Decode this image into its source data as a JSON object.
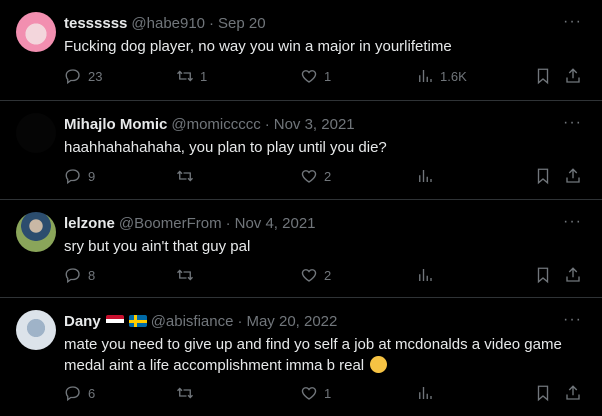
{
  "tweets": [
    {
      "name": "tessssss",
      "handle": "@habe910",
      "dot": "·",
      "date": "Sep 20",
      "text": "Fucking dog player, no way you win a major in yourlifetime",
      "replies": "23",
      "retweets": "1",
      "likes": "1",
      "views": "1.6K",
      "more": "···"
    },
    {
      "name": "Mihajlo Momic",
      "handle": "@momiccccc",
      "dot": "·",
      "date": "Nov 3, 2021",
      "text": "haahhahahahaha, you plan to play until you die?",
      "replies": "9",
      "retweets": "",
      "likes": "2",
      "views": "",
      "more": "···"
    },
    {
      "name": "lelzone",
      "handle": "@BoomerFrom",
      "dot": "·",
      "date": "Nov 4, 2021",
      "text": "sry but you ain't that guy pal",
      "replies": "8",
      "retweets": "",
      "likes": "2",
      "views": "",
      "more": "···"
    },
    {
      "name": "Dany",
      "handle": "@abisfiance",
      "dot": "·",
      "date": "May 20, 2022",
      "text": "mate you need to give up and find yo self a job at mcdonalds a video game medal aint a life accomplishment imma b real",
      "replies": "6",
      "retweets": "",
      "likes": "1",
      "views": "",
      "more": "···"
    }
  ],
  "icons": [
    "reply-icon",
    "retweet-icon",
    "like-icon",
    "views-icon",
    "bookmark-icon",
    "share-icon",
    "more-icon"
  ],
  "colors": {
    "background": "#000000",
    "text": "#e7e9ea",
    "muted": "#71767b",
    "divider": "#2f3336"
  }
}
